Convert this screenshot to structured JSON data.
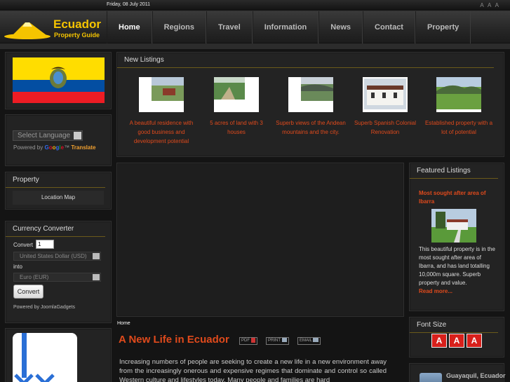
{
  "topbar": {
    "date": "Friday, 08 July 2011",
    "font_size_links": "A A A"
  },
  "brand": {
    "line1": "Ecuador",
    "line2": "Property Guide"
  },
  "nav": [
    {
      "label": "Home",
      "active": true
    },
    {
      "label": "Regions"
    },
    {
      "label": "Travel"
    },
    {
      "label": "Information"
    },
    {
      "label": "News"
    },
    {
      "label": "Contact"
    },
    {
      "label": "Property"
    }
  ],
  "language": {
    "select_placeholder": "Select Language",
    "powered_by": "Powered by",
    "google": [
      "G",
      "o",
      "o",
      "g",
      "l",
      "e"
    ],
    "tm": "™",
    "translate": "Translate"
  },
  "property_module": {
    "title": "Property",
    "location_map": "Location Map"
  },
  "currency": {
    "title": "Currency Converter",
    "convert_label": "Convert",
    "amount": "1",
    "from": "United States Dollar (USD)",
    "into_label": "into",
    "to": "Euro (EUR)",
    "button": "Convert",
    "powered": "Powered by JoomlaGadgets"
  },
  "new_listings": {
    "title": "New Listings",
    "items": [
      {
        "caption": "A beautiful residence with good business and development potential"
      },
      {
        "caption": "5 acres of land with 3 houses"
      },
      {
        "caption": "Superb views of the Andean mountains and the city."
      },
      {
        "caption": "Superb Spanish Colonial Renovation"
      },
      {
        "caption": "Established property with a lot of potential"
      }
    ]
  },
  "content": {
    "breadcrumb": "Home",
    "title": "A New Life in Ecuador",
    "pdf": "PDF",
    "print": "PRINT",
    "email": "EMAIL",
    "body": "Increasing numbers of people are seeking to create a new life in a new environment away from the increasingly onerous and expensive regimes that dominate and control so called Western culture and lifestyles today. Many people and families are hard"
  },
  "featured": {
    "title": "Featured Listings",
    "headline": "Most sought after area of Ibarra",
    "text": "This beautiful property is in the most sought after area of Ibarra, and has land totalling 10,000m square. Superb property and value.",
    "more": "Read more..."
  },
  "font_size": {
    "title": "Font Size",
    "buttons": [
      "A",
      "A",
      "A"
    ]
  },
  "city_label": "Guayaquil, Ecuador",
  "colors": {
    "accent": "#e04a1c",
    "brand": "#f5c400",
    "background": "#141414"
  }
}
